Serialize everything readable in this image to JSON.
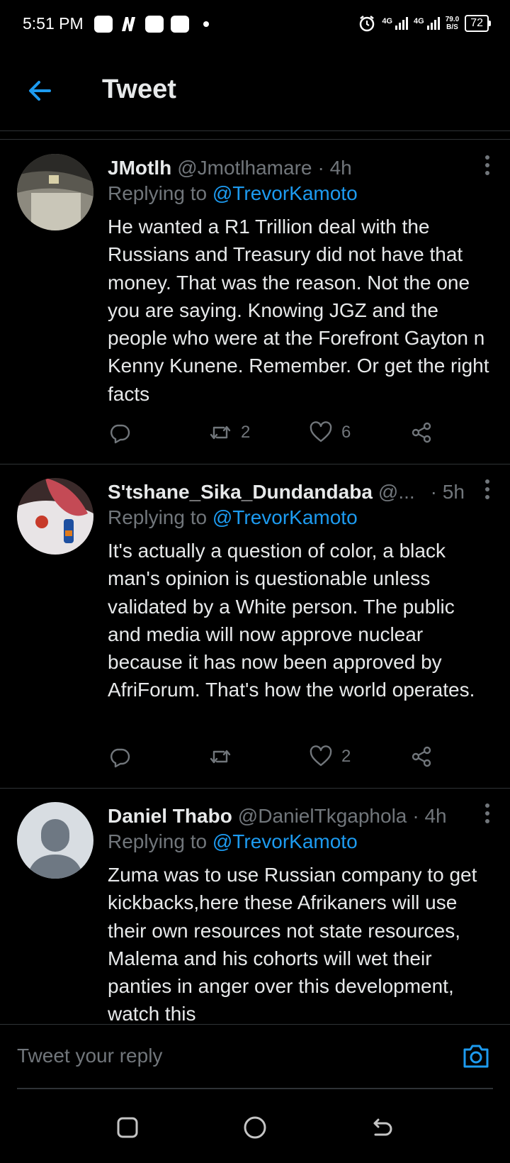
{
  "status_bar": {
    "time": "5:51 PM",
    "network_1": "4G",
    "network_2": "4G",
    "speed_value": "79.0",
    "speed_unit": "B/S",
    "battery": "72"
  },
  "header": {
    "title": "Tweet"
  },
  "tweets": [
    {
      "name": "JMotlh",
      "handle": "@Jmotlhamare",
      "time": "· 4h",
      "replying_prefix": "Replying to ",
      "replying_to": "@TrevorKamoto",
      "text": "He wanted a R1 Trillion deal with the Russians and Treasury did not have that money. That was the reason. Not the one you are saying. Knowing JGZ and the people who were at the Forefront Gayton n Kenny Kunene. Remember. Or get the right facts",
      "retweets": "2",
      "likes": "6"
    },
    {
      "name": "S'tshane_Sika_Dundandaba",
      "handle": "@...",
      "time": "· 5h",
      "replying_prefix": "Replying to ",
      "replying_to": "@TrevorKamoto",
      "text": "It's actually a question of color, a black man's opinion is questionable unless validated by a White person. The public and media will now approve nuclear because it has now been approved by AfriForum. That's how the world operates.",
      "retweets": "",
      "likes": "2"
    },
    {
      "name": "Daniel Thabo",
      "handle": "@DanielTkgaphola",
      "time": "· 4h",
      "replying_prefix": "Replying to ",
      "replying_to": "@TrevorKamoto",
      "text": "Zuma was to use Russian company to get kickbacks,here these Afrikaners will use their own resources not state resources, Malema and his cohorts will wet their panties in anger over this development, watch this"
    }
  ],
  "composer": {
    "placeholder": "Tweet your reply"
  },
  "colors": {
    "accent": "#1d9bf0",
    "muted": "#71767b",
    "text": "#e7e9ea",
    "background": "#000000"
  }
}
